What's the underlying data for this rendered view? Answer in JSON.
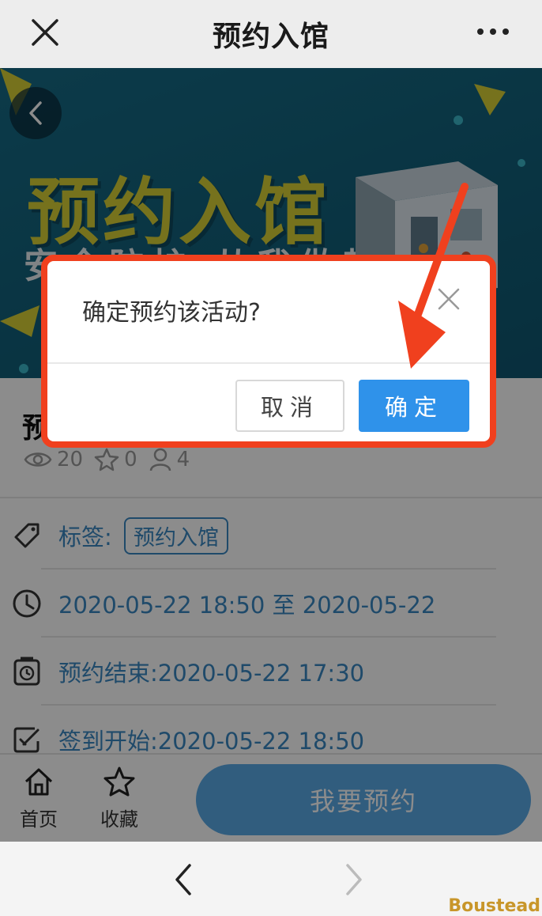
{
  "nav": {
    "title": "预约入馆"
  },
  "banner": {
    "headline": "预约入馆",
    "subline": "安全防护 从我做起"
  },
  "activity": {
    "title": "预",
    "views": "20",
    "favorites": "0",
    "participants": "4"
  },
  "details": {
    "tag_label": "标签:",
    "tag_value": "预约入馆",
    "time_range": "2020-05-22 18:50 至 2020-05-22",
    "booking_end": "预约结束:2020-05-22 17:30",
    "checkin_start": "签到开始:2020-05-22 18:50"
  },
  "actionbar": {
    "home_label": "首页",
    "favorite_label": "收藏",
    "reserve_label": "我要预约"
  },
  "dialog": {
    "message": "确定预约该活动?",
    "cancel_label": "取消",
    "confirm_label": "确定"
  },
  "watermark": "Boustead",
  "colors": {
    "accent_blue": "#3a87c2",
    "confirm_blue": "#2f92ea",
    "highlight_red": "#f0401e",
    "banner_yellow": "#d7cf36"
  }
}
